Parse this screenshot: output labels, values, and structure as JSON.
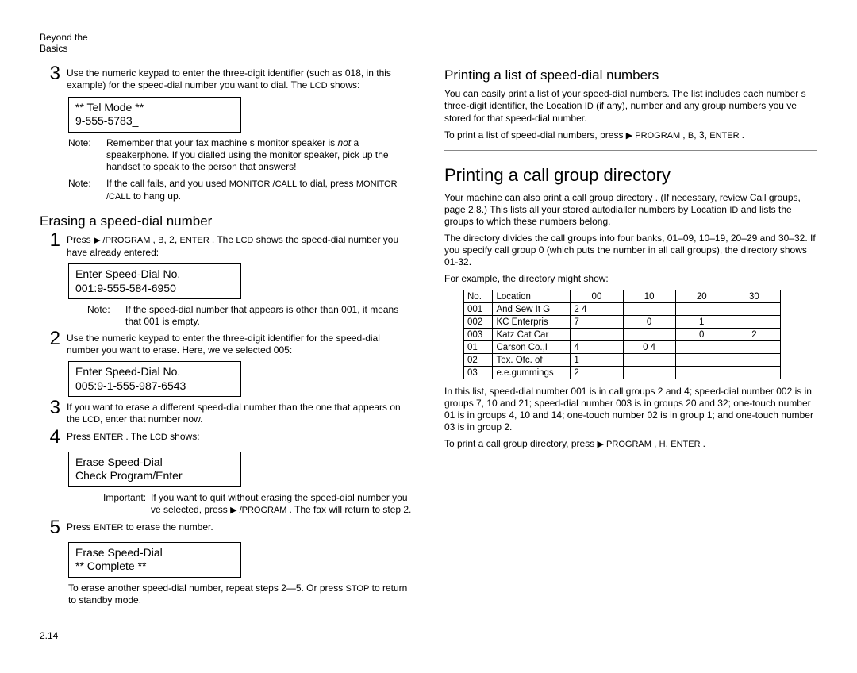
{
  "header": "Beyond the Basics",
  "pageNum": "2.14",
  "left": {
    "step3_num": "3",
    "step3_text_a": "Use the numeric keypad to enter the three-digit identifier (such as ",
    "step3_text_b": "018",
    "step3_text_c": ", in this example) for the speed-dial number you want to dial. The ",
    "step3_text_d": "LCD",
    "step3_text_e": " shows:",
    "lcd1_line1": "**  Tel Mode  **",
    "lcd1_line2": "9-555-5783_",
    "note1_label": "Note:",
    "note1_body_a": "Remember that your fax machine s monitor speaker is ",
    "note1_body_b": "not",
    "note1_body_c": " a speakerphone. If you dialled using the monitor speaker, pick up the handset to speak to the person that answers!",
    "note2_label": "Note:",
    "note2_body_a": "If the call fails, and you used ",
    "note2_body_b": "MONITOR /CALL",
    "note2_body_c": " to dial, press ",
    "note2_body_d": "MONITOR /CALL",
    "note2_body_e": " to hang up.",
    "erasing_heading": "Erasing a speed-dial number",
    "e1_num": "1",
    "e1_a": "Press ",
    "e1_b": "▶ /PROGRAM ",
    "e1_c": ", ",
    "e1_d": "B",
    "e1_e": ", ",
    "e1_f": "2",
    "e1_g": ", ",
    "e1_h": "ENTER ",
    "e1_i": ". The ",
    "e1_j": "LCD",
    "e1_k": " shows the speed-dial number you have already entered:",
    "lcd2_line1": "Enter Speed-Dial No.",
    "lcd2_line2": "001:9-555-584-6950",
    "e1_note_label": "Note:",
    "e1_note_a": "If the speed-dial number that appears is other than ",
    "e1_note_b": "001",
    "e1_note_c": ", it means that  001 is empty.",
    "e2_num": "2",
    "e2_a": "Use the numeric keypad to enter the three-digit identifier for the speed-dial number you want to erase. Here, we ve selected  005:",
    "lcd3_line1": "Enter Speed-Dial No.",
    "lcd3_line2": "005:9-1-555-987-6543",
    "e3_num": "3",
    "e3_a": "If you want to erase a different speed-dial number than the one that appears on the ",
    "e3_b": "LCD",
    "e3_c": ", enter that number now.",
    "e4_num": "4",
    "e4_a": "Press ",
    "e4_b": "ENTER ",
    "e4_c": ". The ",
    "e4_d": "LCD",
    "e4_e": " shows:",
    "lcd4_line1": "Erase Speed-Dial",
    "lcd4_line2": "Check Program/Enter",
    "imp_label": "Important:",
    "imp_a": "If you want to quit without erasing the speed-dial number you ve selected, press ",
    "imp_b": "▶ /PROGRAM ",
    "imp_c": ". The fax will return to step 2.",
    "e5_num": "5",
    "e5_a": "Press ",
    "e5_b": "ENTER",
    "e5_c": " to erase the number.",
    "lcd5_line1": "Erase Speed-Dial",
    "lcd5_line2": "  **  Complete  **",
    "footer_a": "To erase another speed-dial number, repeat steps 2—5. Or press ",
    "footer_b": "STOP",
    "footer_c": " to return to standby mode."
  },
  "right": {
    "print_heading": "Printing a list of speed-dial numbers",
    "p1_a": "You can easily print a list of your speed-dial numbers. The list includes each number s three-digit identifier, the Location ",
    "p1_b": "ID",
    "p1_c": " (if any), number and any group numbers you ve stored for that speed-dial number.",
    "p2_a": "To print a list of speed-dial numbers, press ",
    "p2_b": "▶ PROGRAM ",
    "p2_c": ", ",
    "p2_d": "B",
    "p2_e": ", ",
    "p2_f": "3",
    "p2_g": ", ",
    "p2_h": "ENTER ",
    "p2_i": ".",
    "callgroup_heading": "Printing a call group directory",
    "cg1_a": "Your machine can also print a  call group directory . (If necessary, review  Call groups,  page 2.8.) This lists all your stored autodialler numbers by Location ",
    "cg1_b": "ID",
    "cg1_c": " and lists the groups to which these numbers belong.",
    "cg2": "The directory divides the call groups into four banks,  01–09, 10–19, 20–29 and 30–32. If you specify call group  0 (which puts the number in all call groups), the directory shows 01-32.",
    "cg3": "For example, the directory might show:",
    "table": {
      "headers": [
        "No.",
        "Location",
        "00",
        "10",
        "20",
        "30"
      ],
      "rows": [
        [
          "001",
          "And Sew It G",
          "2 4",
          "",
          "",
          ""
        ],
        [
          "002",
          "KC Enterpris",
          "7",
          "0",
          "1",
          ""
        ],
        [
          "003",
          "Katz Cat Car",
          "",
          "",
          "0",
          "2"
        ],
        [
          "01",
          "Carson Co.,I",
          "4",
          "0  4",
          "",
          ""
        ],
        [
          "02",
          "Tex. Ofc. of",
          "1",
          "",
          "",
          ""
        ],
        [
          "03",
          "e.e.gummings",
          "2",
          "",
          "",
          ""
        ]
      ]
    },
    "cg4": "In this list, speed-dial number  001 is in call groups 2 and 4; speed-dial number  002 is in groups 7, 10 and 21; speed-dial number  003 is in groups 20 and 32; one-touch number  01 is in groups 4, 10 and 14; one-touch number  02 is in group 1; and one-touch number  03 is in group 2.",
    "cg5_a": "To print a call group directory, press ",
    "cg5_b": "▶ PROGRAM ",
    "cg5_c": ", ",
    "cg5_d": "H",
    "cg5_e": ", ",
    "cg5_f": "ENTER ",
    "cg5_g": "."
  }
}
